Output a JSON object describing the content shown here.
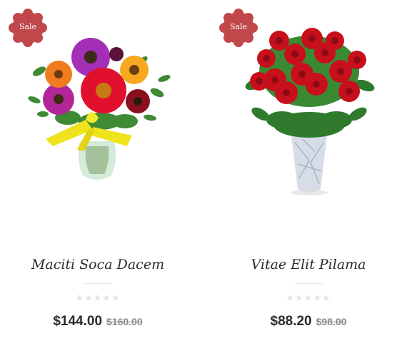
{
  "products": [
    {
      "badge": "Sale",
      "image_icon": "gerbera-bouquet-image",
      "title": "Maciti Soca Dacem",
      "rating": 0,
      "rating_max": 5,
      "price": "$144.00",
      "old_price": "$160.00",
      "colors": {
        "badge": "#c0474a"
      }
    },
    {
      "badge": "Sale",
      "image_icon": "red-roses-vase-image",
      "title": "Vitae Elit Pilama",
      "rating": 0,
      "rating_max": 5,
      "price": "$88.20",
      "old_price": "$98.00",
      "colors": {
        "badge": "#c0474a"
      }
    }
  ],
  "star_icon": "star-icon"
}
